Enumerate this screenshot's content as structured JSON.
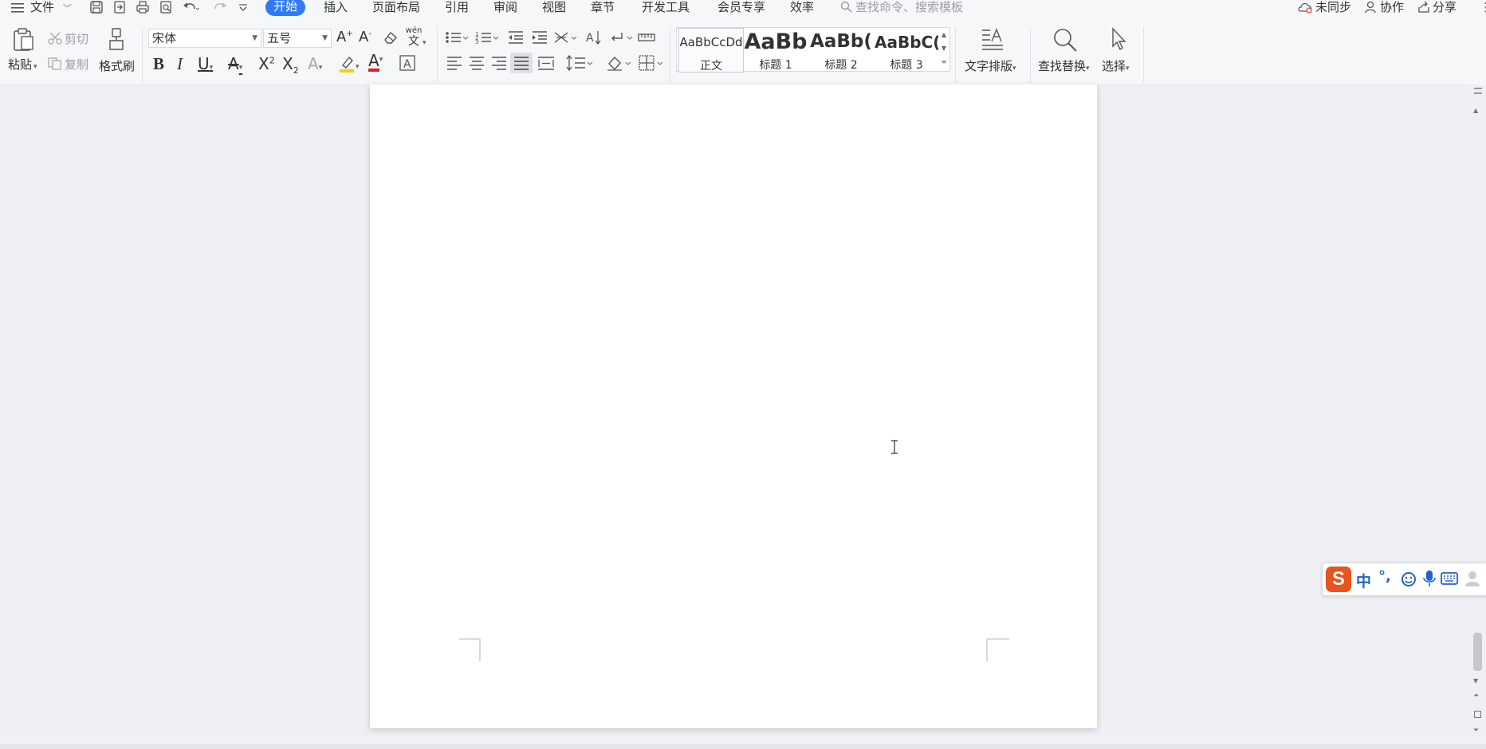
{
  "menu": {
    "file_label": "文件",
    "tabs": [
      {
        "label": "开始",
        "active": true
      },
      {
        "label": "插入"
      },
      {
        "label": "页面布局"
      },
      {
        "label": "引用"
      },
      {
        "label": "审阅"
      },
      {
        "label": "视图"
      },
      {
        "label": "章节"
      },
      {
        "label": "开发工具"
      },
      {
        "label": "会员专享"
      },
      {
        "label": "效率"
      }
    ],
    "search_placeholder": "查找命令、搜索模板",
    "right": {
      "sync_label": "未同步",
      "collab_label": "协作",
      "share_label": "分享"
    }
  },
  "ribbon": {
    "paste_label": "粘贴",
    "cut_label": "剪切",
    "copy_label": "复制",
    "format_painter_label": "格式刷",
    "font_name": "宋体",
    "font_size": "五号",
    "phonetic_label": "wén",
    "styles": [
      {
        "preview": "AaBbCcDd",
        "label": "正文"
      },
      {
        "preview": "AaBb",
        "label": "标题 1"
      },
      {
        "preview": "AaBb(",
        "label": "标题 2"
      },
      {
        "preview": "AaBbC(",
        "label": "标题 3"
      }
    ],
    "text_layout_label": "文字排版",
    "find_replace_label": "查找替换",
    "select_label": "选择"
  },
  "ime": {
    "logo": "S",
    "mode": "中",
    "punct": "°,"
  },
  "colors": {
    "accent": "#2f7af5",
    "highlight": "#f5d000",
    "font_color": "#e02020",
    "ime_logo": "#e8541e",
    "ime_icons": "#2363c9"
  }
}
